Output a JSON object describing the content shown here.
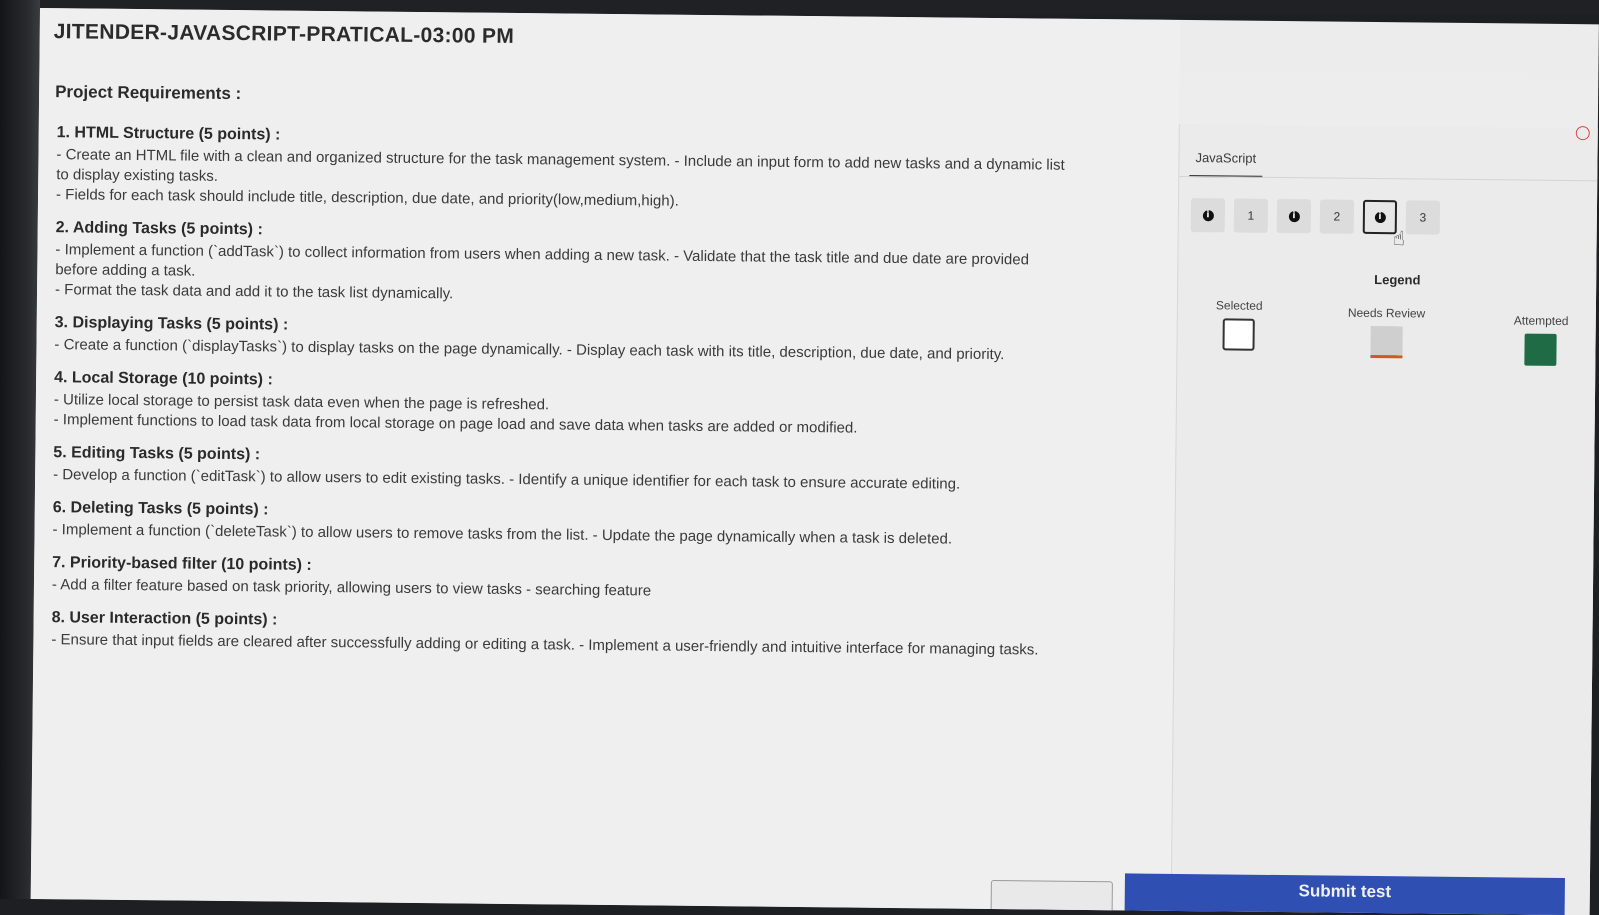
{
  "page": {
    "title": "JITENDER-JAVASCRIPT-PRATICAL-03:00 PM",
    "requirements_heading": "Project Requirements :"
  },
  "sections": [
    {
      "title": "1. HTML Structure (5 points) :",
      "lines": [
        "- Create an HTML file with a clean and organized structure for the task management system. - Include an input form to add new tasks and a dynamic list",
        "to display existing tasks.",
        "- Fields for each task should include title, description, due date, and priority(low,medium,high)."
      ]
    },
    {
      "title": "2. Adding Tasks (5 points) :",
      "lines": [
        "- Implement a function (`addTask`) to collect information from users when adding a new task. - Validate that the task title and due date are provided",
        "before adding a task.",
        "- Format the task data and add it to the task list dynamically."
      ]
    },
    {
      "title": "3. Displaying Tasks (5 points) :",
      "lines": [
        "- Create a function (`displayTasks`) to display tasks on the page dynamically. - Display each task with its title, description, due date, and priority."
      ]
    },
    {
      "title": "4. Local Storage (10 points) :",
      "lines": [
        "- Utilize local storage to persist task data even when the page is refreshed.",
        "- Implement functions to load task data from local storage on page load and save data when tasks are added or modified."
      ]
    },
    {
      "title": "5. Editing Tasks (5 points) :",
      "lines": [
        "- Develop a function (`editTask`) to allow users to edit existing tasks. - Identify a unique identifier for each task to ensure accurate editing."
      ]
    },
    {
      "title": "6. Deleting Tasks (5 points) :",
      "lines": [
        "- Implement a function (`deleteTask`) to allow users to remove tasks from the list. - Update the page dynamically when a task is deleted."
      ]
    },
    {
      "title": "7. Priority-based filter (10 points) :",
      "lines": [
        "- Add a filter feature based on task priority, allowing users to view tasks - searching feature"
      ]
    },
    {
      "title": "8. User Interaction (5 points) :",
      "lines": [
        "- Ensure that input fields are cleared after successfully adding or editing a task. - Implement a user-friendly and intuitive interface for managing tasks."
      ]
    }
  ],
  "sidebar": {
    "tab_label": "JavaScript",
    "questions": [
      "1",
      "2",
      "3"
    ],
    "info_glyph": "i",
    "current_question": "3",
    "legend": {
      "title": "Legend",
      "selected": "Selected",
      "needs_review": "Needs Review",
      "attempted": "Attempted"
    }
  },
  "footer": {
    "submit_label": "Submit test"
  },
  "colors": {
    "attempted": "#1e6b45",
    "needs_review_mark": "#d9541e",
    "submit_bg": "#2f4fb3"
  }
}
